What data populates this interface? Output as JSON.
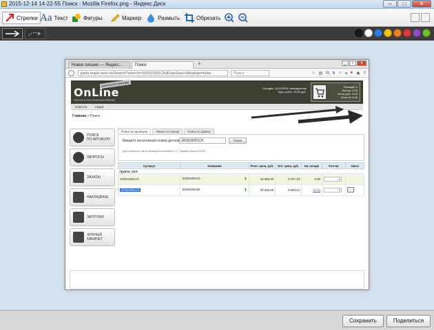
{
  "window": {
    "title": "2015-12-14 14-22-55 Поиск - Mozilla Firefox.png - Яндекс.Диск",
    "minimize": "‒",
    "maximize": "□",
    "close": "✕"
  },
  "toolbar": {
    "tools": [
      {
        "label": "Стрелки",
        "icon": "arrow-icon"
      },
      {
        "label": "Текст",
        "icon": "text-icon"
      },
      {
        "label": "Фигуры",
        "icon": "shapes-icon"
      },
      {
        "label": "Маркер",
        "icon": "marker-icon"
      },
      {
        "label": "Размыть",
        "icon": "blur-icon"
      },
      {
        "label": "Обрезать",
        "icon": "crop-icon"
      }
    ],
    "text_icon_glyph": "Aa"
  },
  "palette": {
    "colors": [
      "#1a1a1a",
      "#ffffff",
      "#2f7de1",
      "#f3c21a",
      "#f07f2a",
      "#e23a3a",
      "#8f4fc2",
      "#6fbf2a"
    ]
  },
  "browser": {
    "tabs": [
      "Новое письмо — Яндекс...",
      "Поиск"
    ],
    "new_tab": "+",
    "url": "parts.major-auto.ru/Search?search=1K0915051CK&UseSearchAnalogs=false",
    "search_placeholder": "Поиск"
  },
  "site": {
    "logo": "OnLine",
    "logo_badge": "ЗАПЧАСТИ ОНЛАЙН",
    "logo_tagline": "РАБОТА В ПОСТОЯННОМ РЕЖИМЕ",
    "info_line1": "Сегодня: 14/12/2015, понедельник",
    "info_line2": "Курс учета: 70,80 руб.",
    "cart_lines": [
      "Позиций: 0",
      "Кол-во: 0,00",
      "Итого руб.: 0,00",
      "Итого $: 0,00"
    ],
    "menu": [
      "Новости",
      "Акции"
    ],
    "breadcrumb_home": "Главная",
    "breadcrumb_sep": " > ",
    "breadcrumb_current": "Поиск"
  },
  "sidebar": {
    "items": [
      {
        "label1": "ПОИСК",
        "label2": "ПО АРТИКУЛУ"
      },
      {
        "label1": "ЗАПРОСЫ",
        "label2": ""
      },
      {
        "label1": "ЗАКАЗЫ",
        "label2": ""
      },
      {
        "label1": "НАКЛАДНЫЕ",
        "label2": ""
      },
      {
        "label1": "ЗАГРУЗКИ",
        "label2": ""
      },
      {
        "label1": "ЛИЧНЫЙ",
        "label2": "КАБИНЕТ"
      }
    ]
  },
  "search": {
    "tabs": [
      "Поиск по артикулу",
      "Поиск по списку",
      "Поиск по файлу"
    ],
    "label": "Введите каталожный номер детали:",
    "value": "1K0915051CK",
    "button": "Поиск",
    "hint": "Для поиска по части номера используйте «*», Пример поиска 0K30*"
  },
  "results": {
    "columns": [
      "Артикул",
      "Название",
      "Розн. цена, руб.",
      "Опт. цена, руб.",
      "На складе",
      "Кол-во",
      "Заказ"
    ],
    "group": "Группа: VAG",
    "rows": [
      {
        "article": "1K0915051CK",
        "name": "1K0915051cb",
        "retail": "15 555,40",
        "wholesale": "9 047,33",
        "stock": "0,00",
        "qty": "1"
      },
      {
        "article": "1K0915051CK",
        "name": "1K0915051bk",
        "retail": "20 555,08",
        "wholesale": "9 890,03",
        "stock": "10,00",
        "qty": "1"
      }
    ]
  },
  "footer": {
    "save": "Сохранить",
    "share": "Поделиться"
  }
}
